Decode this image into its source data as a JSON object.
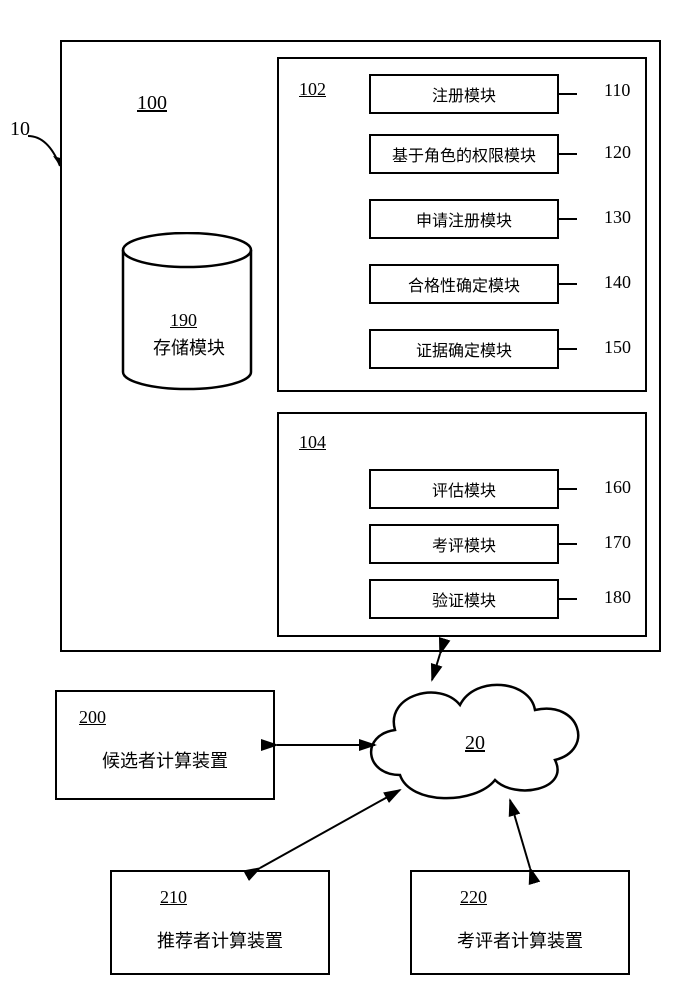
{
  "system_ref": "10",
  "main": {
    "ref": "100",
    "storage": {
      "ref": "190",
      "label": "存储模块"
    },
    "group102": {
      "ref": "102",
      "modules": [
        {
          "label": "注册模块",
          "ref": "110"
        },
        {
          "label": "基于角色的权限模块",
          "ref": "120"
        },
        {
          "label": "申请注册模块",
          "ref": "130"
        },
        {
          "label": "合格性确定模块",
          "ref": "140"
        },
        {
          "label": "证据确定模块",
          "ref": "150"
        }
      ]
    },
    "group104": {
      "ref": "104",
      "modules": [
        {
          "label": "评估模块",
          "ref": "160"
        },
        {
          "label": "考评模块",
          "ref": "170"
        },
        {
          "label": "验证模块",
          "ref": "180"
        }
      ]
    }
  },
  "cloud_ref": "20",
  "candidate": {
    "ref": "200",
    "label": "候选者计算装置"
  },
  "recommender": {
    "ref": "210",
    "label": "推荐者计算装置"
  },
  "evaluator": {
    "ref": "220",
    "label": "考评者计算装置"
  }
}
